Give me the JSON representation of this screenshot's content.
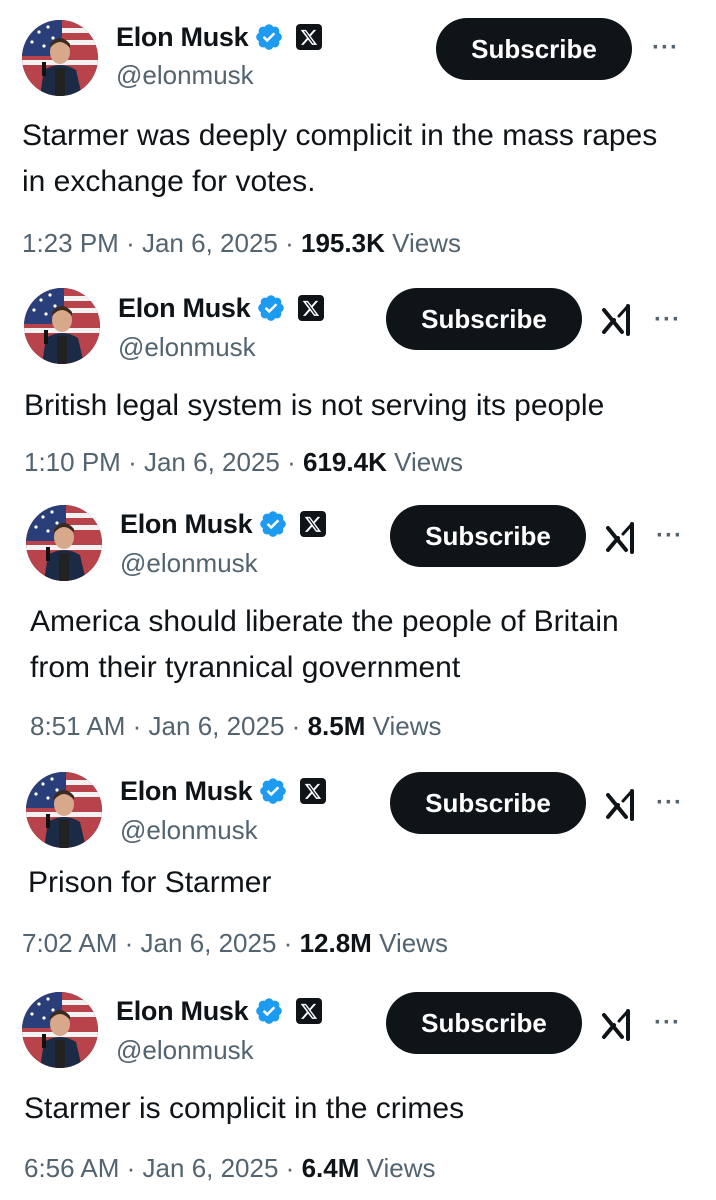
{
  "common": {
    "name": "Elon Musk",
    "handle": "@elonmusk",
    "subscribe_label": "Subscribe",
    "more_label": "···",
    "views_label": "Views",
    "separator": "·",
    "icons": [
      "verified-badge-icon",
      "x-logo-icon",
      "grok-icon",
      "more-icon"
    ],
    "colors": {
      "verified": "#1d9bf0",
      "button": "#0f1419",
      "secondary_text": "#536471"
    }
  },
  "tweets": [
    {
      "text": "Starmer was deeply complicit in the mass rapes in exchange for votes.",
      "time": "1:23 PM",
      "date": "Jan 6, 2025",
      "views": "195.3K"
    },
    {
      "text": "British legal system is not serving its people",
      "time": "1:10 PM",
      "date": "Jan 6, 2025",
      "views": "619.4K"
    },
    {
      "text": "America should liberate the people of Britain from their tyrannical government",
      "time": "8:51 AM",
      "date": "Jan 6, 2025",
      "views": "8.5M"
    },
    {
      "text": "Prison for Starmer",
      "time": "7:02 AM",
      "date": "Jan 6, 2025",
      "views": "12.8M"
    },
    {
      "text": "Starmer is complicit in the crimes",
      "time": "6:56 AM",
      "date": "Jan 6, 2025",
      "views": "6.4M"
    }
  ]
}
